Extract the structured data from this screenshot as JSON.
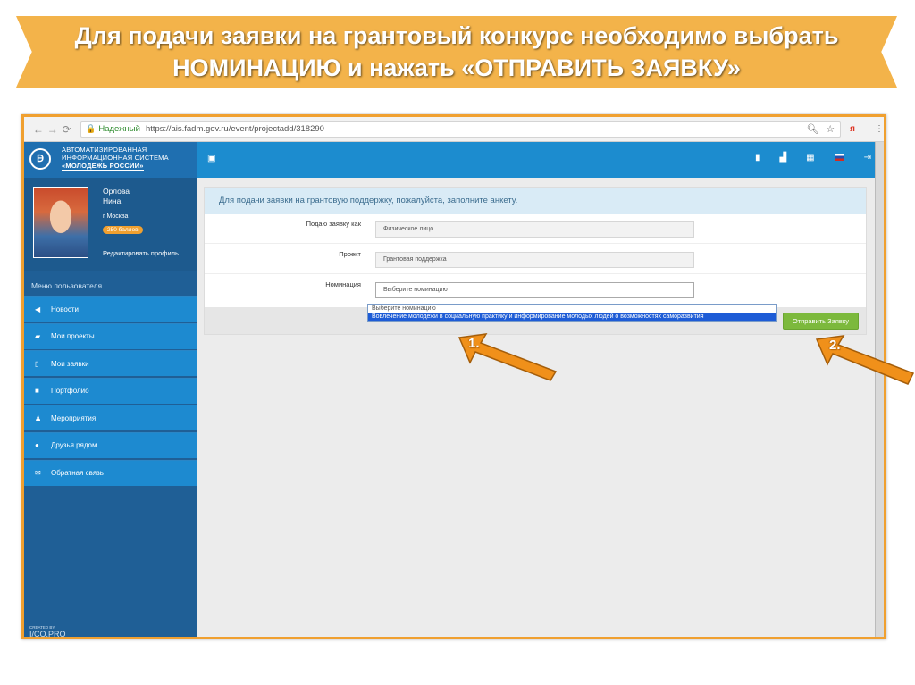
{
  "banner": {
    "line1": "Для подачи заявки на грантовый конкурс необходимо выбрать",
    "line2": "НОМИНАЦИЮ и нажать «ОТПРАВИТЬ ЗАЯВКУ»"
  },
  "browser": {
    "secure_label": "Надежный",
    "url": "https://ais.fadm.gov.ru/event/projectadd/318290",
    "back_icon": "back-arrow-icon",
    "forward_icon": "forward-arrow-icon",
    "reload_icon": "reload-icon"
  },
  "header": {
    "logo_line1": "АВТОМАТИЗИРОВАННАЯ",
    "logo_line2": "ИНФОРМАЦИОННАЯ СИСТЕМА",
    "logo_line3": "«МОЛОДЕЖЬ РОССИИ»"
  },
  "profile": {
    "last_name": "Орлова",
    "first_name": "Нина",
    "city": "г Москва",
    "points": "250 баллов",
    "edit_link": "Редактировать профиль"
  },
  "sidebar": {
    "caption": "Меню пользователя",
    "items": [
      {
        "label": "Новости",
        "icon": "megaphone-icon"
      },
      {
        "label": "Мои проекты",
        "icon": "book-icon"
      },
      {
        "label": "Мои заявки",
        "icon": "bookmark-icon"
      },
      {
        "label": "Портфолио",
        "icon": "folder-icon"
      },
      {
        "label": "Мероприятия",
        "icon": "people-icon"
      },
      {
        "label": "Друзья рядом",
        "icon": "location-pin-icon"
      },
      {
        "label": "Обратная связь",
        "icon": "envelope-icon"
      }
    ],
    "footer_small": "CREATED BY",
    "footer": "I/CO.PRO"
  },
  "form": {
    "heading": "Для подачи заявки на грантовую поддержку, пожалуйста, заполните анкету.",
    "applicant_label": "Подаю заявку как",
    "applicant_value": "Физическое лицо",
    "project_label": "Проект",
    "project_value": "Грантовая поддержка",
    "nomination_label": "Номинация",
    "nomination_value": "Выберите номинацию",
    "options": [
      "Выберите номинацию",
      "Вовлечение молодежи в социальную практику и информирование молодых людей о возможностях саморазвития"
    ],
    "submit_label": "Отправить Заявку"
  },
  "callouts": {
    "step1": "1.",
    "step2": "2."
  },
  "colors": {
    "banner": "#f3b34a",
    "accent_blue": "#1c8ccf",
    "sidebar": "#1f5f96",
    "submit_green": "#7cb93c",
    "arrow_orange": "#f0901a"
  }
}
